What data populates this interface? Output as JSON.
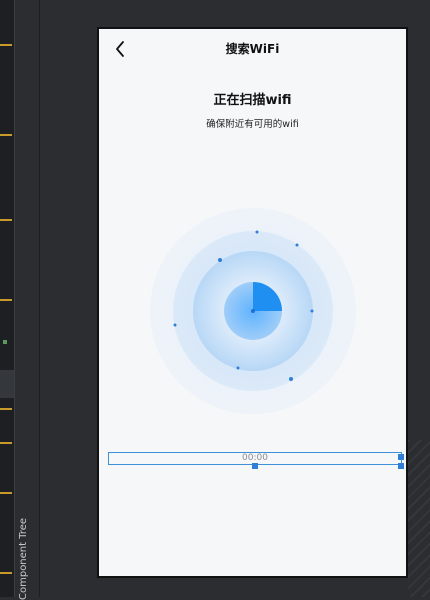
{
  "ide": {
    "component_tree_label": "Component Tree"
  },
  "phone": {
    "nav": {
      "title": "搜索WiFi",
      "back_icon": "chevron-left-icon"
    },
    "scan": {
      "title": "正在扫描wifi",
      "subtitle": "确保附近有可用的wifi"
    },
    "timer": {
      "value": "00:00"
    }
  },
  "colors": {
    "accent": "#2f8ff0",
    "selection": "#3f8fd8",
    "phone_background": "#f6f7f9",
    "ide_background": "#2b2d30"
  }
}
